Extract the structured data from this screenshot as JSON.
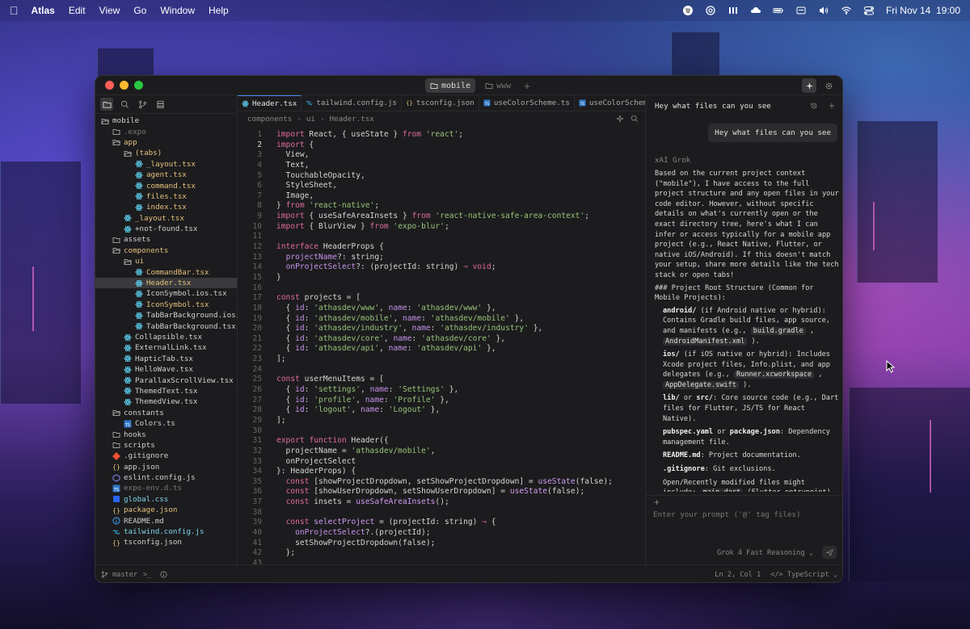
{
  "menubar": {
    "app_name": "Atlas",
    "items": [
      "Edit",
      "View",
      "Go",
      "Window",
      "Help"
    ],
    "clock": "Fri Nov 14  19:00"
  },
  "window": {
    "project_tabs": [
      {
        "label": "mobile",
        "icon": "folder-icon",
        "active": true
      },
      {
        "label": "www",
        "icon": "folder-icon",
        "active": false
      }
    ]
  },
  "sidebar": {
    "tree": [
      {
        "label": "mobile",
        "icon": "folder-open",
        "depth": 0,
        "color": "default"
      },
      {
        "label": ".expo",
        "icon": "folder",
        "depth": 1,
        "color": "dim"
      },
      {
        "label": "app",
        "icon": "folder-open",
        "depth": 1,
        "color": "yellow"
      },
      {
        "label": "(tabs)",
        "icon": "folder-open",
        "depth": 2,
        "color": "yellow"
      },
      {
        "label": "_layout.tsx",
        "icon": "react",
        "depth": 3,
        "color": "yellow"
      },
      {
        "label": "agent.tsx",
        "icon": "react",
        "depth": 3,
        "color": "yellow"
      },
      {
        "label": "command.tsx",
        "icon": "react",
        "depth": 3,
        "color": "yellow"
      },
      {
        "label": "files.tsx",
        "icon": "react",
        "depth": 3,
        "color": "yellow"
      },
      {
        "label": "index.tsx",
        "icon": "react",
        "depth": 3,
        "color": "yellow"
      },
      {
        "label": "_layout.tsx",
        "icon": "react",
        "depth": 2,
        "color": "yellow"
      },
      {
        "label": "+not-found.tsx",
        "icon": "react",
        "depth": 2,
        "color": "default"
      },
      {
        "label": "assets",
        "icon": "folder",
        "depth": 1,
        "color": "default"
      },
      {
        "label": "components",
        "icon": "folder-open",
        "depth": 1,
        "color": "yellow"
      },
      {
        "label": "ui",
        "icon": "folder-open",
        "depth": 2,
        "color": "yellow"
      },
      {
        "label": "CommandBar.tsx",
        "icon": "react",
        "depth": 3,
        "color": "yellow"
      },
      {
        "label": "Header.tsx",
        "icon": "react",
        "depth": 3,
        "color": "yellow",
        "selected": true
      },
      {
        "label": "IconSymbol.ios.tsx",
        "icon": "react",
        "depth": 3,
        "color": "default"
      },
      {
        "label": "IconSymbol.tsx",
        "icon": "react",
        "depth": 3,
        "color": "yellow"
      },
      {
        "label": "TabBarBackground.ios.tsx",
        "icon": "react",
        "depth": 3,
        "color": "default"
      },
      {
        "label": "TabBarBackground.tsx",
        "icon": "react",
        "depth": 3,
        "color": "default"
      },
      {
        "label": "Collapsible.tsx",
        "icon": "react",
        "depth": 2,
        "color": "default"
      },
      {
        "label": "ExternalLink.tsx",
        "icon": "react",
        "depth": 2,
        "color": "default"
      },
      {
        "label": "HapticTab.tsx",
        "icon": "react",
        "depth": 2,
        "color": "default"
      },
      {
        "label": "HelloWave.tsx",
        "icon": "react",
        "depth": 2,
        "color": "default"
      },
      {
        "label": "ParallaxScrollView.tsx",
        "icon": "react",
        "depth": 2,
        "color": "default"
      },
      {
        "label": "ThemedText.tsx",
        "icon": "react",
        "depth": 2,
        "color": "default"
      },
      {
        "label": "ThemedView.tsx",
        "icon": "react",
        "depth": 2,
        "color": "default"
      },
      {
        "label": "constants",
        "icon": "folder-open",
        "depth": 1,
        "color": "default"
      },
      {
        "label": "Colors.ts",
        "icon": "ts",
        "depth": 2,
        "color": "default"
      },
      {
        "label": "hooks",
        "icon": "folder",
        "depth": 1,
        "color": "default"
      },
      {
        "label": "scripts",
        "icon": "folder",
        "depth": 1,
        "color": "default"
      },
      {
        "label": ".gitignore",
        "icon": "git",
        "depth": 1,
        "color": "default"
      },
      {
        "label": "app.json",
        "icon": "json",
        "depth": 1,
        "color": "default"
      },
      {
        "label": "eslint.config.js",
        "icon": "eslint",
        "depth": 1,
        "color": "default"
      },
      {
        "label": "expo-env.d.ts",
        "icon": "ts",
        "depth": 1,
        "color": "dim"
      },
      {
        "label": "global.css",
        "icon": "css",
        "depth": 1,
        "color": "cyan"
      },
      {
        "label": "package.json",
        "icon": "json",
        "depth": 1,
        "color": "yellow"
      },
      {
        "label": "README.md",
        "icon": "info",
        "depth": 1,
        "color": "default"
      },
      {
        "label": "tailwind.config.js",
        "icon": "tailwind",
        "depth": 1,
        "color": "cyan"
      },
      {
        "label": "tsconfig.json",
        "icon": "json",
        "depth": 1,
        "color": "default"
      }
    ]
  },
  "editor": {
    "tabs": [
      {
        "label": "Header.tsx",
        "icon": "react",
        "active": true
      },
      {
        "label": "tailwind.config.js",
        "icon": "tailwind",
        "active": false
      },
      {
        "label": "tsconfig.json",
        "icon": "json",
        "active": false
      },
      {
        "label": "useColorScheme.ts",
        "icon": "ts",
        "active": false
      },
      {
        "label": "useColorScheme.web.ts",
        "icon": "ts",
        "active": false
      },
      {
        "label": "use",
        "icon": "ts",
        "active": false
      }
    ],
    "breadcrumb": [
      "components",
      "ui",
      "Header.tsx"
    ],
    "current_line": 2,
    "lines": [
      "[k:import] React, { useState } [k:from] [s:'react'];",
      "[k:import] {",
      "  View,",
      "  Text,",
      "  TouchableOpacity,",
      "  StyleSheet,",
      "  Image,",
      "} [k:from] [s:'react-native'];",
      "[k:import] { useSafeAreaInsets } [k:from] [s:'react-native-safe-area-context'];",
      "[k:import] { BlurView } [k:from] [s:'expo-blur'];",
      "",
      "[k:interface] HeaderProps {",
      "  [p:projectName]?: string;",
      "  [p:onProjectSelect]?: (projectId: string) [k:⇒] [k:void];",
      "}",
      "",
      "[k:const] projects = [",
      "  { [p:id]: [s:'athasdev/www'], [p:name]: [s:'athasdev/www'] },",
      "  { [p:id]: [s:'athasdev/mobile'], [p:name]: [s:'athasdev/mobile'] },",
      "  { [p:id]: [s:'athasdev/industry'], [p:name]: [s:'athasdev/industry'] },",
      "  { [p:id]: [s:'athasdev/core'], [p:name]: [s:'athasdev/core'] },",
      "  { [p:id]: [s:'athasdev/api'], [p:name]: [s:'athasdev/api'] },",
      "];",
      "",
      "[k:const] userMenuItems = [",
      "  { [p:id]: [s:'settings'], [p:name]: [s:'Settings'] },",
      "  { [p:id]: [s:'profile'], [p:name]: [s:'Profile'] },",
      "  { [p:id]: [s:'logout'], [p:name]: [s:'Logout'] },",
      "];",
      "",
      "[k:export] [k:function] Header({",
      "  projectName = [s:'athasdev/mobile'],",
      "  onProjectSelect",
      "}: HeaderProps) {",
      "  [k:const] [showProjectDropdown, setShowProjectDropdown] = [f:useState](false);",
      "  [k:const] [showUserDropdown, setShowUserDropdown] = [f:useState](false);",
      "  [k:const] insets = [f:useSafeAreaInsets]();",
      "",
      "  [k:const] [f:selectProject] = (projectId: string) [k:⇒] {",
      "    [p:onProjectSelect]?.(projectId);",
      "    setShowProjectDropdown(false);",
      "  };",
      ""
    ]
  },
  "chat": {
    "title": "Hey what files can you see",
    "user_message": "Hey what files can you see",
    "model_label": "xAI Grok",
    "reply_paragraphs": [
      "Based on the current project context (\"mobile\"), I have access to the full project structure and any open files in your code editor. However, without specific details on what's currently open or the exact directory tree, here's what I can infer or access typically for a mobile app project (e.g., React Native, Flutter, or native iOS/Android). If this doesn't match your setup, share more details like the tech stack or open tabs!",
      "### Project Root Structure (Common for Mobile Projects):"
    ],
    "reply_items": [
      {
        "strong": "android/",
        "text": " (if Android native or hybrid): Contains Gradle build files, app source, and manifests (e.g., ",
        "codes": [
          "build.gradle",
          "AndroidManifest.xml"
        ],
        "joiner": " , ",
        "tail": " )."
      },
      {
        "strong": "ios/",
        "text": " (if iOS native or hybrid): Includes Xcode project files, Info.plist, and app delegates (e.g., ",
        "codes": [
          "Runner.xcworkspace",
          "AppDelegate.swift"
        ],
        "joiner": " , ",
        "tail": " )."
      },
      {
        "strong": "lib/",
        "text": " or ",
        "strong2": "src/",
        "text2": ": Core source code (e.g., Dart files for Flutter, JS/TS for React Native)."
      },
      {
        "strong": "pubspec.yaml",
        "text": " or ",
        "strong2": "package.json",
        "text2": ": Dependency management file."
      },
      {
        "strong": "README.md",
        "text": ": Project documentation."
      },
      {
        "strong": ".gitignore",
        "text": ": Git exclusions."
      },
      {
        "text": "Open/Recently modified files might include: ",
        "codes3": [
          "main.dart",
          "App.js",
          "index.js"
        ],
        "mid1": " (Flutter entrypoint), ",
        "mid2": " (React Native), or ",
        "tail": " ."
      }
    ],
    "reply_cutoff": "If you're sharing file contents (e.g., via",
    "input_placeholder": "Enter your prompt ('@' tag files)",
    "model_select": "Grok 4 Fast Reasoning"
  },
  "statusbar": {
    "branch": "master",
    "position": "Ln 2, Col 1",
    "language": "TypeScript"
  }
}
